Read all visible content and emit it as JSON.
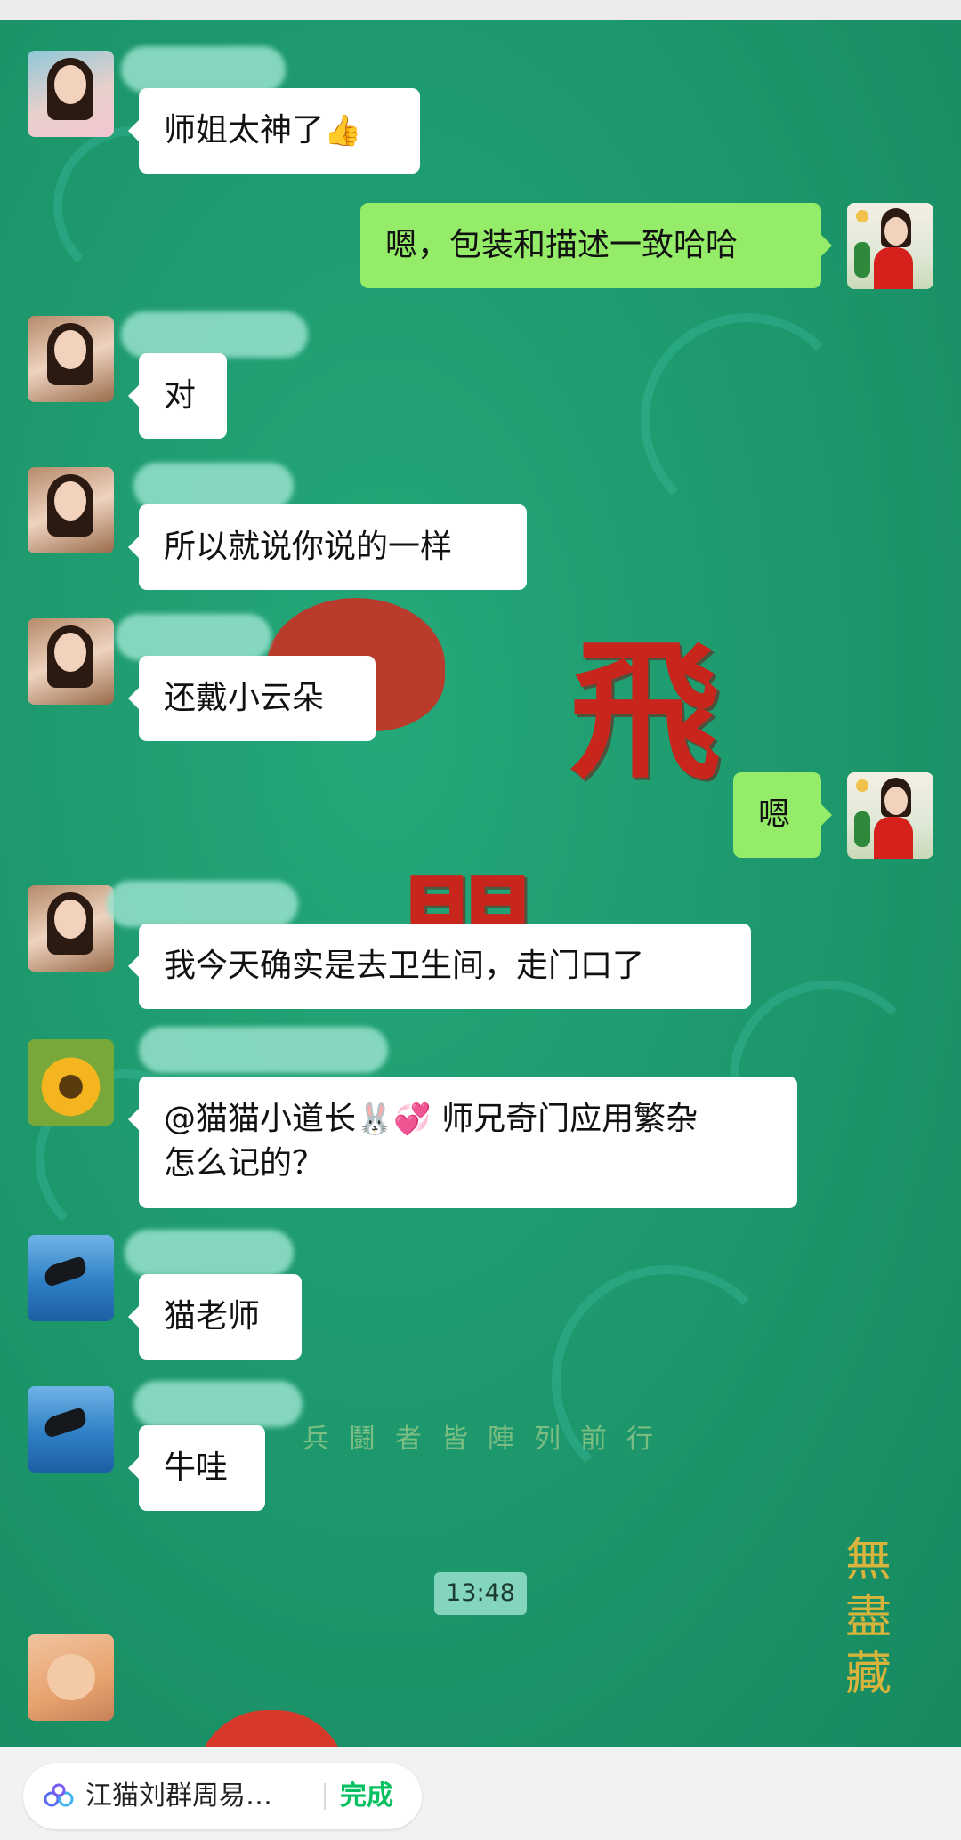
{
  "background": {
    "glyph_1": "飛",
    "glyph_2": "閃",
    "motto": "兵鬪者皆陣列前行",
    "vertical_text": [
      "無",
      "盡",
      "藏"
    ]
  },
  "messages": [
    {
      "side": "left",
      "avatar": "avatar-woman-glasses",
      "text": "师姐太神了",
      "emoji": "👍"
    },
    {
      "side": "right",
      "avatar": "avatar-red-robe",
      "text": "嗯，包装和描述一致哈哈"
    },
    {
      "side": "left",
      "avatar": "avatar-woman-long-hair",
      "text": "对"
    },
    {
      "side": "left",
      "avatar": "avatar-woman-long-hair",
      "text": "所以就说你说的一样"
    },
    {
      "side": "left",
      "avatar": "avatar-woman-long-hair",
      "text": "还戴小云朵"
    },
    {
      "side": "right",
      "avatar": "avatar-red-robe",
      "text": "嗯"
    },
    {
      "side": "left",
      "avatar": "avatar-woman-long-hair",
      "text": "我今天确实是去卫生间，走门口了"
    },
    {
      "side": "left",
      "avatar": "avatar-sunflower",
      "text_part1": "@猫猫小道长",
      "emoji1": "🐰",
      "emoji2": "💞",
      "text_part2": " 师兄奇门应用繁杂",
      "text_line2": "怎么记的？"
    },
    {
      "side": "left",
      "avatar": "avatar-orca",
      "text": "猫老师"
    },
    {
      "side": "left",
      "avatar": "avatar-orca",
      "text": "牛哇"
    }
  ],
  "timestamp": "13:48",
  "mini_program_bar": {
    "icon": "mini-program-icon",
    "title": "江猫刘群周易…",
    "done_label": "完成"
  },
  "colors": {
    "chat_background": "#1e9a6e",
    "bubble_self": "#95ec69",
    "bubble_other": "#ffffff",
    "done_green": "#07c160"
  }
}
